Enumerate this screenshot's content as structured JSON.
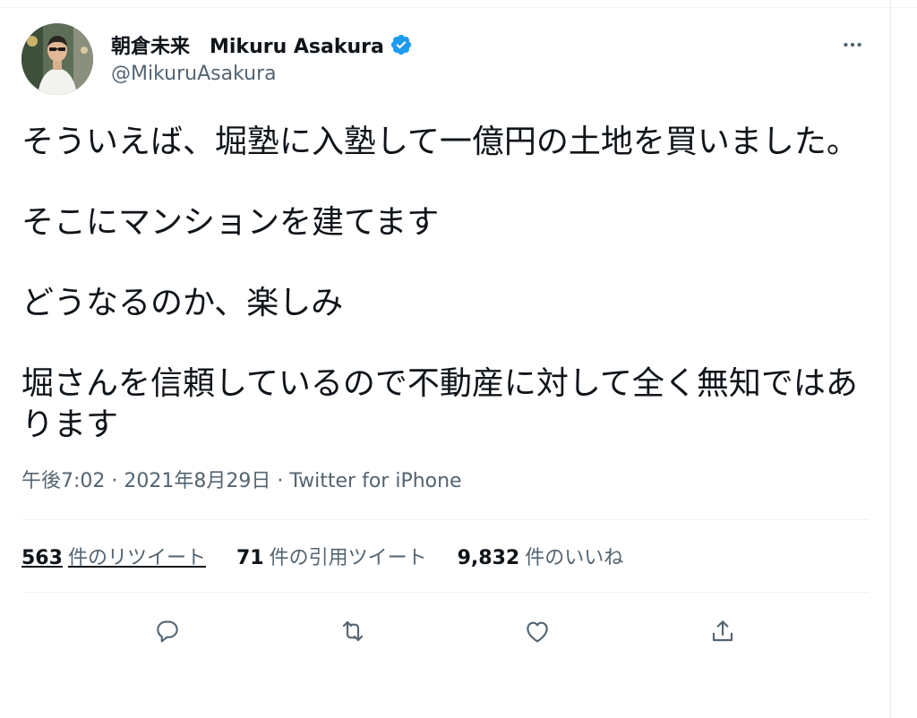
{
  "author": {
    "display_name": "朝倉未来　Mikuru Asakura",
    "handle": "@MikuruAsakura"
  },
  "tweet": {
    "paragraphs": [
      "そういえば、堀塾に入塾して一億円の土地を買いました。",
      "そこにマンションを建てます",
      "どうなるのか、楽しみ",
      "堀さんを信頼しているので不動産に対して全く無知ではあります"
    ],
    "time": "午後7:02",
    "date": "2021年8月29日",
    "source": "Twitter for iPhone",
    "separator": " · "
  },
  "stats": {
    "retweets_count": "563",
    "retweets_label": "件のリツイート",
    "quotes_count": "71",
    "quotes_label": "件の引用ツイート",
    "likes_count": "9,832",
    "likes_label": "件のいいね"
  },
  "icons": {
    "more": "more-horizontal-icon",
    "reply": "reply-icon",
    "retweet": "retweet-icon",
    "like": "heart-icon",
    "share": "share-icon",
    "verified": "verified-badge-icon"
  },
  "colors": {
    "text": "#0f1419",
    "secondary": "#536471",
    "verified": "#1d9bf0",
    "divider": "#eff3f4"
  }
}
